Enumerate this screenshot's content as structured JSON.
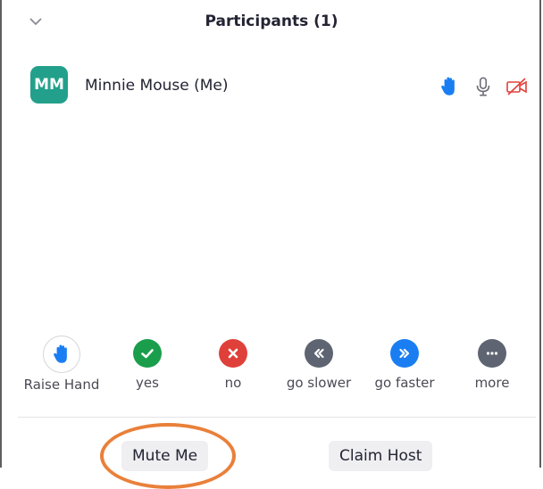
{
  "header": {
    "title": "Participants (1)",
    "collapse_icon": "chevron-down-icon"
  },
  "participant": {
    "initials": "MM",
    "name": "Minnie Mouse (Me)",
    "avatar_color": "#23a08b",
    "icons": [
      "raised-hand-icon",
      "microphone-icon",
      "video-off-icon"
    ]
  },
  "reactions": [
    {
      "label": "Raise Hand",
      "icon": "raise-hand-icon",
      "color": "#ffffff"
    },
    {
      "label": "yes",
      "icon": "check-icon",
      "color": "#1a9e4b"
    },
    {
      "label": "no",
      "icon": "x-icon",
      "color": "#e0403a"
    },
    {
      "label": "go slower",
      "icon": "rewind-icon",
      "color": "#5f6472"
    },
    {
      "label": "go faster",
      "icon": "fast-forward-icon",
      "color": "#1a7ef2"
    },
    {
      "label": "more",
      "icon": "more-icon",
      "color": "#5f6472"
    }
  ],
  "footer": {
    "mute_label": "Mute Me",
    "claim_label": "Claim Host",
    "highlight_color": "#e9803a"
  }
}
